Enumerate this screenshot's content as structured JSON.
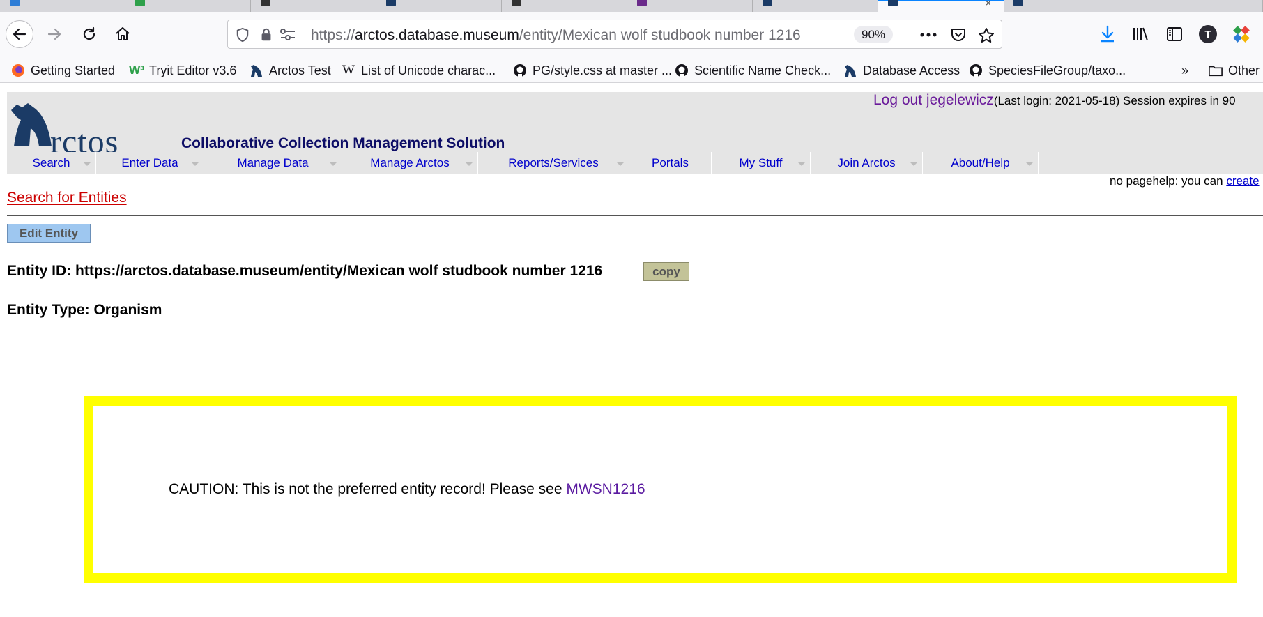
{
  "browser": {
    "url_scheme": "https://",
    "url_host": "arctos.database.museum",
    "url_path": "/entity/Mexican wolf studbook number 1216",
    "zoom": "90%",
    "tab_icon_colors": [
      "#2e7dd6",
      "#2ea04a",
      "#333333",
      "#1b3b66",
      "#333333",
      "#6a2a8a",
      "#1b3b66",
      "#1b3b66",
      "#1b3b66"
    ],
    "bookmarks": [
      {
        "label": "Getting Started",
        "icon": "firefox-icon"
      },
      {
        "label": "Tryit Editor v3.6",
        "icon": "w3schools-icon"
      },
      {
        "label": "Arctos Test",
        "icon": "arctos-icon"
      },
      {
        "label": "List of Unicode charac...",
        "icon": "wikipedia-icon"
      },
      {
        "label": "PG/style.css at master ...",
        "icon": "github-icon"
      },
      {
        "label": "Scientific Name Check...",
        "icon": "github-icon"
      },
      {
        "label": "Database Access",
        "icon": "arctos-icon"
      },
      {
        "label": "SpeciesFileGroup/taxo...",
        "icon": "github-icon"
      }
    ],
    "other_bookmarks": "Other",
    "profile_initial": "T"
  },
  "header": {
    "logo_text": "rctos",
    "tagline": "Collaborative Collection Management Solution",
    "logout_label": "Log out jegelewicz",
    "session_info": "(Last login: 2021-05-18)  Session expires in 90"
  },
  "menu": {
    "items": [
      {
        "label": "Search",
        "has_dropdown": true
      },
      {
        "label": "Enter Data",
        "has_dropdown": true
      },
      {
        "label": "Manage Data",
        "has_dropdown": true
      },
      {
        "label": "Manage Arctos",
        "has_dropdown": true
      },
      {
        "label": "Reports/Services",
        "has_dropdown": true
      },
      {
        "label": "Portals",
        "has_dropdown": false
      },
      {
        "label": "My Stuff",
        "has_dropdown": true
      },
      {
        "label": "Join Arctos",
        "has_dropdown": true
      },
      {
        "label": "About/Help",
        "has_dropdown": true
      }
    ]
  },
  "pagehelp": {
    "text": "no pagehelp: you can ",
    "link": "create"
  },
  "content": {
    "search_link": "Search for Entities",
    "edit_button": "Edit Entity",
    "entity_id": "Entity ID: https://arctos.database.museum/entity/Mexican wolf studbook number 1216",
    "copy_button": "copy",
    "entity_type": "Entity Type: Organism",
    "caution_text": "CAUTION: This is not the preferred entity record! Please see ",
    "caution_link": "MWSN1216"
  },
  "colors": {
    "caution_border": "#ffff00",
    "edit_button_bg": "#9ec7f0",
    "copy_button_bg": "#c3c398",
    "menu_link": "#0000cc",
    "search_link": "#cc0000"
  }
}
